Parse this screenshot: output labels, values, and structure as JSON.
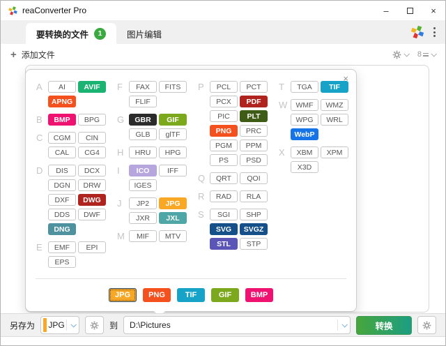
{
  "window": {
    "title": "reaConverter Pro",
    "controls": {
      "minimize": "–",
      "close": "×"
    }
  },
  "tabs": [
    {
      "label": "要转换的文件",
      "badge": "1",
      "active": true
    },
    {
      "label": "图片编辑",
      "active": false
    }
  ],
  "toolbar": {
    "add_files_label": "添加文件",
    "plus_glyph": "+",
    "sort_digit": "8"
  },
  "dialog": {
    "close_glyph": "×",
    "palette": {
      "green": "#1bb371",
      "orangered": "#f4511e",
      "pink": "#ef1270",
      "darkred": "#b02420",
      "teal": "#4e92a0",
      "black": "#2b2b2b",
      "ygreen": "#7ca81d",
      "lavender": "#b7a5dd",
      "amber": "#f9a825",
      "teal2": "#4fa6a6",
      "olive": "#3f5c17",
      "navy": "#15508a",
      "indigo": "#5b55b7",
      "cyan": "#16a3c7",
      "blue": "#1474e8"
    },
    "columns": [
      {
        "groups": [
          {
            "letter": "A",
            "rows": [
              [
                {
                  "label": "AI"
                },
                {
                  "label": "AVIF",
                  "color": "green"
                }
              ],
              [
                {
                  "label": "APNG",
                  "color": "orangered"
                },
                null
              ]
            ]
          },
          {
            "letter": "B",
            "rows": [
              [
                {
                  "label": "BMP",
                  "color": "pink"
                },
                {
                  "label": "BPG"
                }
              ]
            ]
          },
          {
            "letter": "C",
            "rows": [
              [
                {
                  "label": "CGM"
                },
                {
                  "label": "CIN"
                }
              ],
              [
                {
                  "label": "CAL"
                },
                {
                  "label": "CG4"
                }
              ]
            ]
          },
          {
            "letter": "D",
            "rows": [
              [
                {
                  "label": "DIS"
                },
                {
                  "label": "DCX"
                }
              ],
              [
                {
                  "label": "DGN"
                },
                {
                  "label": "DRW"
                }
              ],
              [
                {
                  "label": "DXF"
                },
                {
                  "label": "DWG",
                  "color": "darkred"
                }
              ],
              [
                {
                  "label": "DDS"
                },
                {
                  "label": "DWF"
                }
              ],
              [
                {
                  "label": "DNG",
                  "color": "teal"
                },
                null
              ]
            ]
          },
          {
            "letter": "E",
            "rows": [
              [
                {
                  "label": "EMF"
                },
                {
                  "label": "EPI"
                }
              ],
              [
                {
                  "label": "EPS"
                },
                null
              ]
            ]
          }
        ]
      },
      {
        "groups": [
          {
            "letter": "F",
            "rows": [
              [
                {
                  "label": "FAX"
                },
                {
                  "label": "FITS"
                }
              ],
              [
                {
                  "label": "FLIF"
                },
                null
              ]
            ]
          },
          {
            "letter": "G",
            "rows": [
              [
                {
                  "label": "GBR",
                  "color": "black"
                },
                {
                  "label": "GIF",
                  "color": "ygreen"
                }
              ],
              [
                {
                  "label": "GLB"
                },
                {
                  "label": "glTF"
                }
              ]
            ]
          },
          {
            "letter": "H",
            "rows": [
              [
                {
                  "label": "HRU"
                },
                {
                  "label": "HPG"
                }
              ]
            ]
          },
          {
            "letter": "I",
            "rows": [
              [
                {
                  "label": "ICO",
                  "color": "lavender"
                },
                {
                  "label": "IFF"
                }
              ],
              [
                {
                  "label": "IGES"
                },
                null
              ]
            ]
          },
          {
            "letter": "J",
            "rows": [
              [
                {
                  "label": "JP2"
                },
                {
                  "label": "JPG",
                  "color": "amber"
                }
              ],
              [
                {
                  "label": "JXR"
                },
                {
                  "label": "JXL",
                  "color": "teal2"
                }
              ]
            ]
          },
          {
            "letter": "M",
            "rows": [
              [
                {
                  "label": "MIF"
                },
                {
                  "label": "MTV"
                }
              ]
            ]
          }
        ]
      },
      {
        "groups": [
          {
            "letter": "P",
            "rows": [
              [
                {
                  "label": "PCL"
                },
                {
                  "label": "PCT"
                }
              ],
              [
                {
                  "label": "PCX"
                },
                {
                  "label": "PDF",
                  "color": "darkred"
                }
              ],
              [
                {
                  "label": "PIC"
                },
                {
                  "label": "PLT",
                  "color": "olive"
                }
              ],
              [
                {
                  "label": "PNG",
                  "color": "orangered"
                },
                {
                  "label": "PRC"
                }
              ],
              [
                {
                  "label": "PGM"
                },
                {
                  "label": "PPM"
                }
              ],
              [
                {
                  "label": "PS"
                },
                {
                  "label": "PSD"
                }
              ]
            ]
          },
          {
            "letter": "Q",
            "rows": [
              [
                {
                  "label": "QRT"
                },
                {
                  "label": "QOI"
                }
              ]
            ]
          },
          {
            "letter": "R",
            "rows": [
              [
                {
                  "label": "RAD"
                },
                {
                  "label": "RLA"
                }
              ]
            ]
          },
          {
            "letter": "S",
            "rows": [
              [
                {
                  "label": "SGI"
                },
                {
                  "label": "SHP"
                }
              ],
              [
                {
                  "label": "SVG",
                  "color": "navy"
                },
                {
                  "label": "SVGZ",
                  "color": "navy"
                }
              ],
              [
                {
                  "label": "STL",
                  "color": "indigo"
                },
                {
                  "label": "STP"
                }
              ]
            ]
          }
        ]
      },
      {
        "groups": [
          {
            "letter": "T",
            "rows": [
              [
                {
                  "label": "TGA"
                },
                {
                  "label": "TIF",
                  "color": "cyan"
                }
              ]
            ]
          },
          {
            "letter": "W",
            "rows": [
              [
                {
                  "label": "WMF"
                },
                {
                  "label": "WMZ"
                }
              ],
              [
                {
                  "label": "WPG"
                },
                {
                  "label": "WRL"
                }
              ],
              [
                {
                  "label": "WebP",
                  "color": "blue"
                },
                null
              ]
            ]
          },
          {
            "letter": "X",
            "rows": [
              [
                {
                  "label": "XBM"
                },
                {
                  "label": "XPM"
                }
              ],
              [
                {
                  "label": "X3D"
                },
                null
              ]
            ]
          }
        ]
      }
    ],
    "quick": [
      {
        "label": "JPG",
        "color": "amber",
        "selected": true
      },
      {
        "label": "PNG",
        "color": "orangered",
        "selected": false
      },
      {
        "label": "TIF",
        "color": "cyan",
        "selected": false
      },
      {
        "label": "GIF",
        "color": "ygreen",
        "selected": false
      },
      {
        "label": "BMP",
        "color": "pink",
        "selected": false
      }
    ]
  },
  "bottom": {
    "save_as_label": "另存为",
    "format_value": "JPG",
    "to_label": "到",
    "path_value": "D:\\Pictures",
    "convert_label": "转换"
  },
  "ui_colors": {
    "badge_green": "#3aa93f",
    "format_stripe": "#f9a825",
    "convert_gradient_start": "#47a63b",
    "convert_gradient_end": "#1c9e83",
    "combo_chevron_blue": "#79aedc"
  }
}
